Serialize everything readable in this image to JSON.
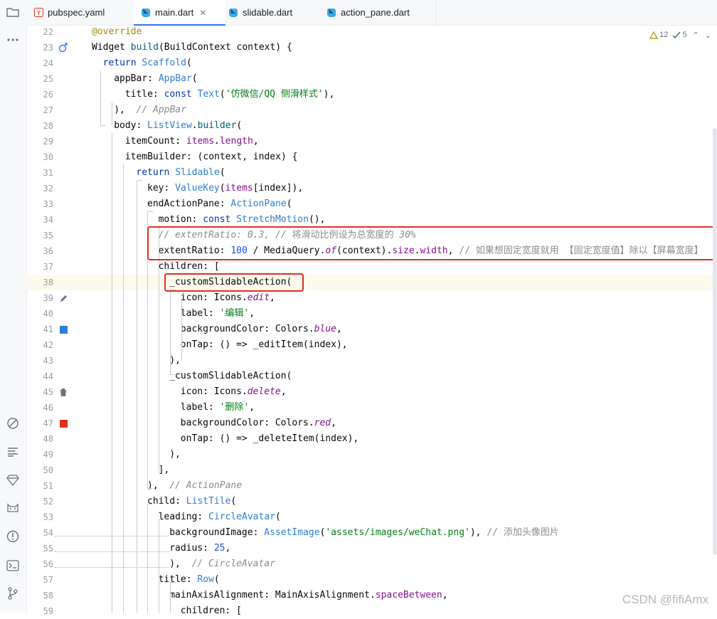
{
  "tabs": [
    {
      "label": "pubspec.yaml",
      "icon": "yaml-file-icon",
      "active": false
    },
    {
      "label": "main.dart",
      "icon": "dart-file-icon",
      "active": true,
      "close": "✕"
    },
    {
      "label": "slidable.dart",
      "icon": "dart-file-icon",
      "active": false
    },
    {
      "label": "action_pane.dart",
      "icon": "dart-file-icon",
      "active": false
    }
  ],
  "inspections": {
    "warnings": "12",
    "checks": "5"
  },
  "watermark": "CSDN @fifiAmx",
  "colors": {
    "accent": "#3574f0",
    "highlight_box": "#e0301e",
    "blue_swatch": "#2f7fd0",
    "red_swatch": "#e0301e"
  },
  "lines": [
    {
      "n": "22",
      "tokens": [
        [
          "ann",
          "@override"
        ]
      ]
    },
    {
      "n": "23",
      "tokens": [
        [
          "",
          "Widget "
        ],
        [
          "fn",
          "build"
        ],
        [
          "",
          "(BuildContext context) {"
        ]
      ]
    },
    {
      "n": "24",
      "tokens": [
        [
          "kw",
          "return "
        ],
        [
          "ty",
          "Scaffold"
        ],
        [
          "",
          "("
        ]
      ]
    },
    {
      "n": "25",
      "tokens": [
        [
          "",
          "appBar: "
        ],
        [
          "ty",
          "AppBar"
        ],
        [
          "",
          "("
        ]
      ]
    },
    {
      "n": "26",
      "tokens": [
        [
          "",
          "title: "
        ],
        [
          "kw",
          "const "
        ],
        [
          "ty",
          "Text"
        ],
        [
          "",
          "("
        ],
        [
          "str",
          "'仿微信/QQ 侧滑样式'"
        ],
        [
          "",
          "),"
        ]
      ]
    },
    {
      "n": "27",
      "tokens": [
        [
          "",
          "),  "
        ],
        [
          "cm",
          "// AppBar"
        ]
      ]
    },
    {
      "n": "28",
      "tokens": [
        [
          "",
          "body: "
        ],
        [
          "ty",
          "ListView"
        ],
        [
          "",
          "."
        ],
        [
          "fn",
          "builder"
        ],
        [
          "",
          "("
        ]
      ]
    },
    {
      "n": "29",
      "tokens": [
        [
          "",
          "itemCount: "
        ],
        [
          "prop",
          "items"
        ],
        [
          "",
          "."
        ],
        [
          "prop",
          "length"
        ],
        [
          "",
          ","
        ]
      ]
    },
    {
      "n": "30",
      "tokens": [
        [
          "",
          "itemBuilder: (context, index) {"
        ]
      ]
    },
    {
      "n": "31",
      "tokens": [
        [
          "kw",
          "return "
        ],
        [
          "ty",
          "Slidable"
        ],
        [
          "",
          "("
        ]
      ]
    },
    {
      "n": "32",
      "tokens": [
        [
          "",
          "key: "
        ],
        [
          "ty",
          "ValueKey"
        ],
        [
          "",
          "("
        ],
        [
          "prop",
          "items"
        ],
        [
          "",
          "[index]),"
        ]
      ]
    },
    {
      "n": "33",
      "tokens": [
        [
          "",
          "endActionPane: "
        ],
        [
          "ty",
          "ActionPane"
        ],
        [
          "",
          "("
        ]
      ]
    },
    {
      "n": "34",
      "tokens": [
        [
          "",
          "motion: "
        ],
        [
          "kw",
          "const "
        ],
        [
          "ty",
          "StretchMotion"
        ],
        [
          "",
          "(),"
        ]
      ]
    },
    {
      "n": "35",
      "tokens": [
        [
          "cm",
          "// extentRatio: 0.3, // "
        ],
        [
          "cmz",
          "将滑动比例设为总宽度的 "
        ],
        [
          "cm",
          "30%"
        ]
      ]
    },
    {
      "n": "36",
      "tokens": [
        [
          "",
          "extentRatio: "
        ],
        [
          "num",
          "100"
        ],
        [
          "",
          " / MediaQuery."
        ],
        [
          "it",
          "of"
        ],
        [
          "",
          "(context)."
        ],
        [
          "prop",
          "size"
        ],
        [
          "",
          "."
        ],
        [
          "prop",
          "width"
        ],
        [
          "",
          ", "
        ],
        [
          "cmz",
          "// 如果想固定宽度就用 【固定宽度值】除以【屏幕宽度】"
        ]
      ]
    },
    {
      "n": "37",
      "tokens": [
        [
          "",
          "children: ["
        ]
      ]
    },
    {
      "n": "38",
      "tokens": [
        [
          "",
          "_customSlidableAction("
        ]
      ]
    },
    {
      "n": "39",
      "tokens": [
        [
          "",
          "icon: Icons."
        ],
        [
          "it",
          "edit"
        ],
        [
          "",
          ","
        ]
      ]
    },
    {
      "n": "40",
      "tokens": [
        [
          "",
          "label: "
        ],
        [
          "str",
          "'编辑'"
        ],
        [
          "",
          ","
        ]
      ]
    },
    {
      "n": "41",
      "tokens": [
        [
          "",
          "backgroundColor: Colors."
        ],
        [
          "it",
          "blue"
        ],
        [
          "",
          ","
        ]
      ]
    },
    {
      "n": "42",
      "tokens": [
        [
          "",
          "onTap: () => _editItem(index),"
        ]
      ]
    },
    {
      "n": "43",
      "tokens": [
        [
          "",
          "),"
        ]
      ]
    },
    {
      "n": "44",
      "tokens": [
        [
          "",
          "_customSlidableAction("
        ]
      ]
    },
    {
      "n": "45",
      "tokens": [
        [
          "",
          "icon: Icons."
        ],
        [
          "it",
          "delete"
        ],
        [
          "",
          ","
        ]
      ]
    },
    {
      "n": "46",
      "tokens": [
        [
          "",
          "label: "
        ],
        [
          "str",
          "'删除'"
        ],
        [
          "",
          ","
        ]
      ]
    },
    {
      "n": "47",
      "tokens": [
        [
          "",
          "backgroundColor: Colors."
        ],
        [
          "it",
          "red"
        ],
        [
          "",
          ","
        ]
      ]
    },
    {
      "n": "48",
      "tokens": [
        [
          "",
          "onTap: () => _deleteItem(index),"
        ]
      ]
    },
    {
      "n": "49",
      "tokens": [
        [
          "",
          "),"
        ]
      ]
    },
    {
      "n": "50",
      "tokens": [
        [
          "",
          "],"
        ]
      ]
    },
    {
      "n": "51",
      "tokens": [
        [
          "",
          "),  "
        ],
        [
          "cm",
          "// ActionPane"
        ]
      ]
    },
    {
      "n": "52",
      "tokens": [
        [
          "",
          "child: "
        ],
        [
          "ty",
          "ListTile"
        ],
        [
          "",
          "("
        ]
      ]
    },
    {
      "n": "53",
      "tokens": [
        [
          "",
          "leading: "
        ],
        [
          "ty",
          "CircleAvatar"
        ],
        [
          "",
          "("
        ]
      ]
    },
    {
      "n": "54",
      "tokens": [
        [
          "",
          "backgroundImage: "
        ],
        [
          "ty",
          "AssetImage"
        ],
        [
          "",
          "("
        ],
        [
          "str",
          "'assets/images/weChat.png'"
        ],
        [
          "",
          "), "
        ],
        [
          "cmz",
          "// 添加头像图片"
        ]
      ]
    },
    {
      "n": "55",
      "tokens": [
        [
          "",
          "radius: "
        ],
        [
          "num",
          "25"
        ],
        [
          "",
          ","
        ]
      ]
    },
    {
      "n": "56",
      "tokens": [
        [
          "",
          "),  "
        ],
        [
          "cm",
          "// CircleAvatar"
        ]
      ]
    },
    {
      "n": "57",
      "tokens": [
        [
          "",
          "title: "
        ],
        [
          "ty",
          "Row"
        ],
        [
          "",
          "("
        ]
      ]
    },
    {
      "n": "58",
      "tokens": [
        [
          "",
          "mainAxisAlignment: MainAxisAlignment."
        ],
        [
          "prop",
          "spaceBetween"
        ],
        [
          "",
          ","
        ]
      ]
    },
    {
      "n": "59",
      "tokens": [
        [
          "",
          "children: ["
        ]
      ]
    }
  ]
}
